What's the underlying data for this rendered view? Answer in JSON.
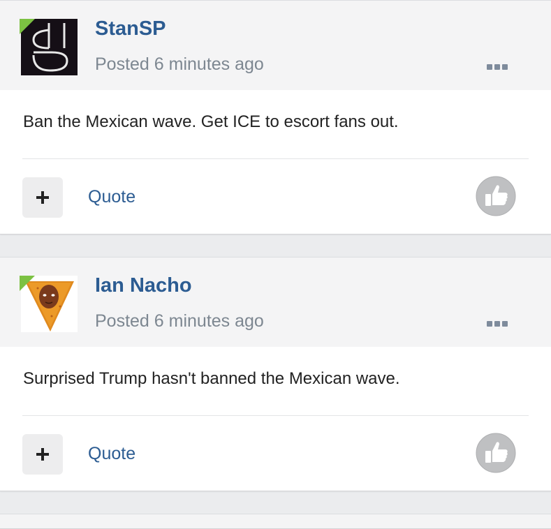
{
  "posts": [
    {
      "author": "StanSP",
      "posted": "Posted 6 minutes ago",
      "content": "Ban the Mexican wave. Get ICE to escort fans out.",
      "quote_label": "Quote",
      "avatar": "dark-monogram-avatar",
      "online": true
    },
    {
      "author": "Ian Nacho",
      "posted": "Posted 6 minutes ago",
      "content": "Surprised Trump hasn't banned the Mexican wave.",
      "quote_label": "Quote",
      "avatar": "nacho-chip-face-avatar",
      "online": true
    }
  ],
  "icons": {
    "more": "more-options-icon",
    "add": "plus-icon",
    "like": "thumbs-up-icon"
  },
  "colors": {
    "author_link": "#2c5c92",
    "online_badge": "#7cc142",
    "like_circle": "#bfc0c2"
  }
}
